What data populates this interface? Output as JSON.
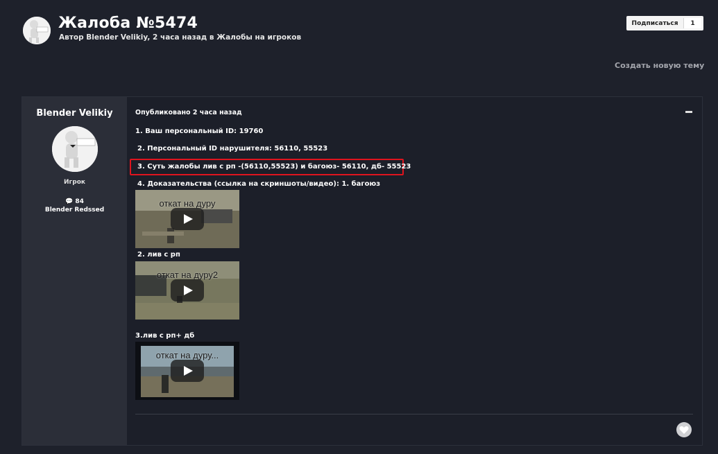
{
  "header": {
    "title": "Жалоба №5474",
    "meta": "Автор Blender Velikiy, 2 часа назад в Жалобы на игроков",
    "follow_label": "Подписаться",
    "follow_count": "1",
    "new_topic": "Создать новую тему"
  },
  "author": {
    "name": "Blender Velikiy",
    "rank": "Игрок",
    "posts": "💬 84",
    "extra": "Blender Redssed"
  },
  "post": {
    "date": "Опубликовано 2 часа назад",
    "lines": [
      "1. Ваш персональный ID: 19760",
      "2. Персональный ID нарушителя: 56110, 55523",
      "3. Суть жалобы лив с рп -(56110,55523) и багоюз- 56110, дб- 55523",
      "4. Доказательства (ссылка на скриншоты/видео):  1. багоюз",
      "2. лив с рп",
      "3.лив с рп+ дб"
    ],
    "videos": [
      {
        "title": "откат на дуру"
      },
      {
        "title": "откат на дуру2"
      },
      {
        "title": "откат на дуру..."
      }
    ]
  },
  "colors": {
    "background": "#1e212b",
    "author_panel": "#2b2e38",
    "highlight": "#e0141e"
  },
  "icons": [
    "avatar-icon",
    "comment-icon",
    "play-icon",
    "heart-icon",
    "collapse-icon"
  ]
}
